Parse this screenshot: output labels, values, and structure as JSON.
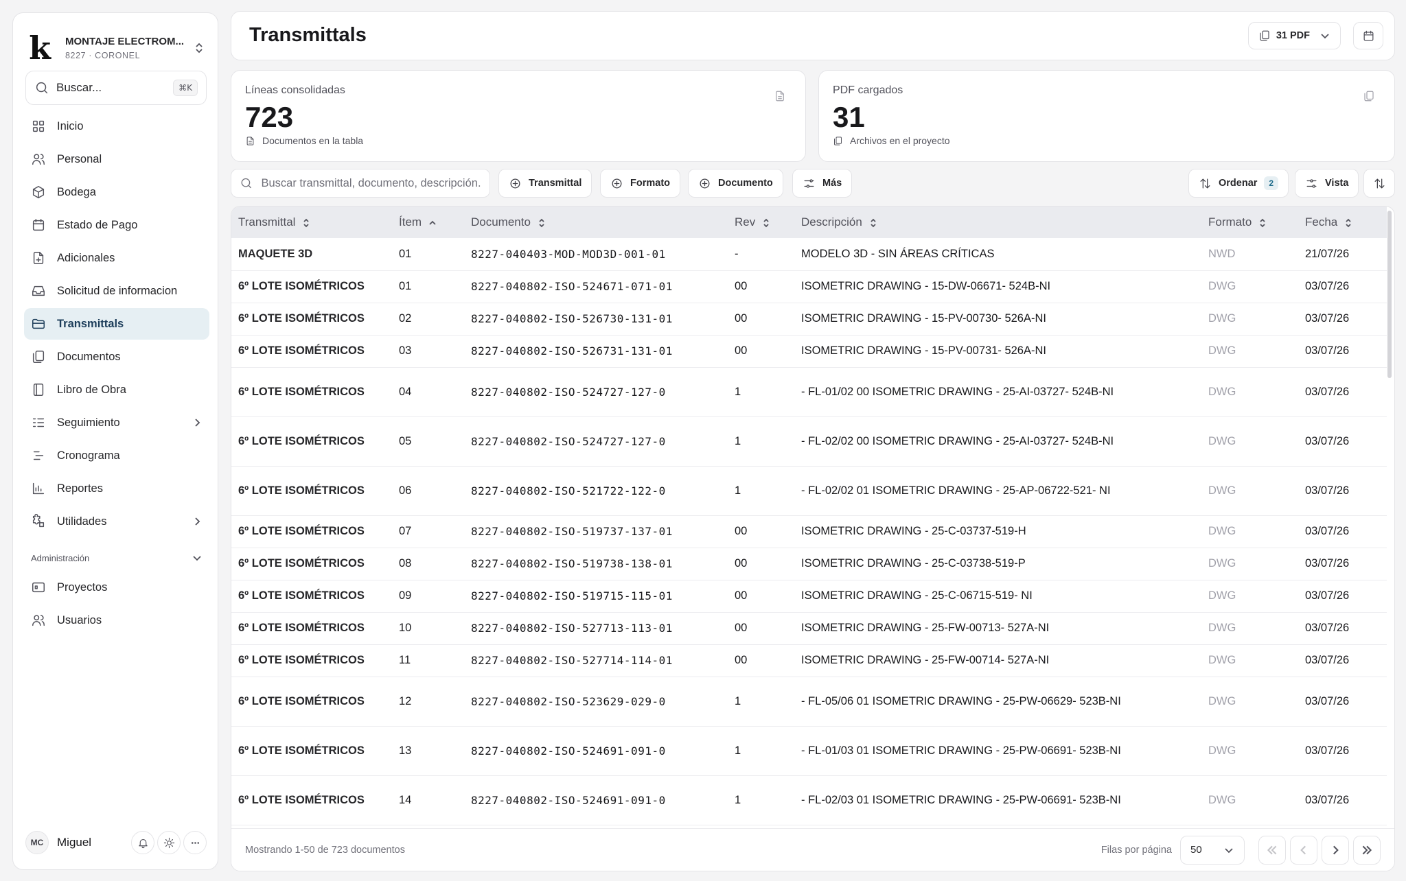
{
  "sidebar": {
    "org_name": "MONTAJE ELECTROM...",
    "org_sub": "8227 · CORONEL",
    "logo": "k",
    "search_placeholder": "Buscar...",
    "search_shortcut": "⌘K",
    "items": [
      {
        "label": "Inicio",
        "icon": "grid-icon"
      },
      {
        "label": "Personal",
        "icon": "users-icon"
      },
      {
        "label": "Bodega",
        "icon": "box-icon"
      },
      {
        "label": "Estado de Pago",
        "icon": "calendar-check-icon"
      },
      {
        "label": "Adicionales",
        "icon": "file-plus-icon"
      },
      {
        "label": "Solicitud de informacion",
        "icon": "inbox-icon"
      },
      {
        "label": "Transmittals",
        "icon": "folder-open-icon",
        "active": true
      },
      {
        "label": "Documentos",
        "icon": "files-icon"
      },
      {
        "label": "Libro de Obra",
        "icon": "book-icon"
      },
      {
        "label": "Seguimiento",
        "icon": "list-check-icon",
        "has_children": true
      },
      {
        "label": "Cronograma",
        "icon": "timeline-icon"
      },
      {
        "label": "Reportes",
        "icon": "bar-chart-icon"
      },
      {
        "label": "Utilidades",
        "icon": "puzzle-icon",
        "has_children": true
      }
    ],
    "admin_section": "Administración",
    "admin_items": [
      {
        "label": "Proyectos",
        "icon": "folder-icon"
      },
      {
        "label": "Usuarios",
        "icon": "users-icon"
      }
    ],
    "user": {
      "initials": "MC",
      "name": "Miguel"
    }
  },
  "header": {
    "title": "Transmittals",
    "pdf_button": "31 PDF"
  },
  "stats": [
    {
      "label": "Líneas consolidadas",
      "value": "723",
      "sub": "Documentos en la tabla"
    },
    {
      "label": "PDF cargados",
      "value": "31",
      "sub": "Archivos en el proyecto"
    }
  ],
  "toolbar": {
    "search_placeholder": "Buscar transmittal, documento, descripción...",
    "btn_transmittal": "Transmittal",
    "btn_formato": "Formato",
    "btn_documento": "Documento",
    "btn_mas": "Más",
    "btn_ordenar": "Ordenar",
    "ordenar_count": "2",
    "btn_vista": "Vista"
  },
  "table": {
    "columns": [
      "Transmittal",
      "Ítem",
      "Documento",
      "Rev",
      "Descripción",
      "Formato",
      "Fecha"
    ],
    "rows": [
      {
        "transmittal": "MAQUETE 3D",
        "item": "01",
        "documento": "8227-040403-MOD-MOD3D-001-01",
        "rev": "-",
        "descripcion": "MODELO 3D - SIN ÁREAS CRÍTICAS",
        "formato": "NWD",
        "fecha": "21/07/26"
      },
      {
        "transmittal": "6º LOTE ISOMÉTRICOS",
        "item": "01",
        "documento": "8227-040802-ISO-524671-071-01",
        "rev": "00",
        "descripcion": "ISOMETRIC DRAWING - 15-DW-06671- 524B-NI",
        "formato": "DWG",
        "fecha": "03/07/26"
      },
      {
        "transmittal": "6º LOTE ISOMÉTRICOS",
        "item": "02",
        "documento": "8227-040802-ISO-526730-131-01",
        "rev": "00",
        "descripcion": "ISOMETRIC DRAWING - 15-PV-00730- 526A-NI",
        "formato": "DWG",
        "fecha": "03/07/26"
      },
      {
        "transmittal": "6º LOTE ISOMÉTRICOS",
        "item": "03",
        "documento": "8227-040802-ISO-526731-131-01",
        "rev": "00",
        "descripcion": "ISOMETRIC DRAWING - 15-PV-00731- 526A-NI",
        "formato": "DWG",
        "fecha": "03/07/26"
      },
      {
        "transmittal": "6º LOTE ISOMÉTRICOS",
        "item": "04",
        "documento": "8227-040802-ISO-524727-127-0",
        "rev": "1",
        "descripcion": "- FL-01/02 00 ISOMETRIC DRAWING - 25-AI-03727- 524B-NI",
        "formato": "DWG",
        "fecha": "03/07/26"
      },
      {
        "transmittal": "6º LOTE ISOMÉTRICOS",
        "item": "05",
        "documento": "8227-040802-ISO-524727-127-0",
        "rev": "1",
        "descripcion": "- FL-02/02 00 ISOMETRIC DRAWING - 25-AI-03727- 524B-NI",
        "formato": "DWG",
        "fecha": "03/07/26"
      },
      {
        "transmittal": "6º LOTE ISOMÉTRICOS",
        "item": "06",
        "documento": "8227-040802-ISO-521722-122-0",
        "rev": "1",
        "descripcion": "- FL-02/02 01 ISOMETRIC DRAWING - 25-AP-06722-521- NI",
        "formato": "DWG",
        "fecha": "03/07/26"
      },
      {
        "transmittal": "6º LOTE ISOMÉTRICOS",
        "item": "07",
        "documento": "8227-040802-ISO-519737-137-01",
        "rev": "00",
        "descripcion": "ISOMETRIC DRAWING - 25-C-03737-519-H",
        "formato": "DWG",
        "fecha": "03/07/26"
      },
      {
        "transmittal": "6º LOTE ISOMÉTRICOS",
        "item": "08",
        "documento": "8227-040802-ISO-519738-138-01",
        "rev": "00",
        "descripcion": "ISOMETRIC DRAWING - 25-C-03738-519-P",
        "formato": "DWG",
        "fecha": "03/07/26"
      },
      {
        "transmittal": "6º LOTE ISOMÉTRICOS",
        "item": "09",
        "documento": "8227-040802-ISO-519715-115-01",
        "rev": "00",
        "descripcion": "ISOMETRIC DRAWING - 25-C-06715-519- NI",
        "formato": "DWG",
        "fecha": "03/07/26"
      },
      {
        "transmittal": "6º LOTE ISOMÉTRICOS",
        "item": "10",
        "documento": "8227-040802-ISO-527713-113-01",
        "rev": "00",
        "descripcion": "ISOMETRIC DRAWING - 25-FW-00713- 527A-NI",
        "formato": "DWG",
        "fecha": "03/07/26"
      },
      {
        "transmittal": "6º LOTE ISOMÉTRICOS",
        "item": "11",
        "documento": "8227-040802-ISO-527714-114-01",
        "rev": "00",
        "descripcion": "ISOMETRIC DRAWING - 25-FW-00714- 527A-NI",
        "formato": "DWG",
        "fecha": "03/07/26"
      },
      {
        "transmittal": "6º LOTE ISOMÉTRICOS",
        "item": "12",
        "documento": "8227-040802-ISO-523629-029-0",
        "rev": "1",
        "descripcion": "- FL-05/06 01 ISOMETRIC DRAWING - 25-PW-06629- 523B-NI",
        "formato": "DWG",
        "fecha": "03/07/26"
      },
      {
        "transmittal": "6º LOTE ISOMÉTRICOS",
        "item": "13",
        "documento": "8227-040802-ISO-524691-091-0",
        "rev": "1",
        "descripcion": "- FL-01/03 01 ISOMETRIC DRAWING - 25-PW-06691- 523B-NI",
        "formato": "DWG",
        "fecha": "03/07/26"
      },
      {
        "transmittal": "6º LOTE ISOMÉTRICOS",
        "item": "14",
        "documento": "8227-040802-ISO-524691-091-0",
        "rev": "1",
        "descripcion": "- FL-02/03 01 ISOMETRIC DRAWING - 25-PW-06691- 523B-NI",
        "formato": "DWG",
        "fecha": "03/07/26"
      }
    ],
    "footer": {
      "showing": "Mostrando 1-50 de 723 documentos",
      "rows_label": "Filas por página",
      "rows_value": "50"
    }
  },
  "colors": {
    "active_nav_bg": "#e6eff3",
    "active_nav_text": "#1c3d5a",
    "header_row_bg": "#eaebef",
    "muted_text": "#a1a1aa"
  }
}
